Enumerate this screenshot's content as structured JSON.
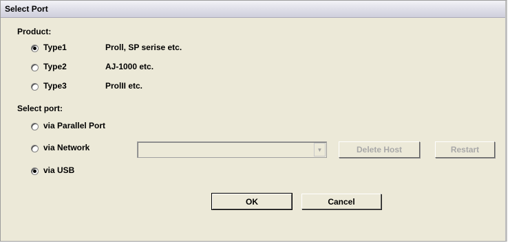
{
  "window": {
    "title": "Select Port"
  },
  "product": {
    "label": "Product:",
    "options": [
      {
        "label": "Type1",
        "desc": "Proll, SP serise etc.",
        "checked": true
      },
      {
        "label": "Type2",
        "desc": "AJ-1000 etc.",
        "checked": false
      },
      {
        "label": "Type3",
        "desc": "ProlII etc.",
        "checked": false
      }
    ]
  },
  "port": {
    "label": "Select port:",
    "options": [
      {
        "label": "via Parallel Port",
        "checked": false
      },
      {
        "label": "via Network",
        "checked": false
      },
      {
        "label": "via USB",
        "checked": true
      }
    ],
    "network_host_value": "",
    "delete_host_label": "Delete Host",
    "restart_label": "Restart"
  },
  "buttons": {
    "ok_label": "OK",
    "cancel_label": "Cancel"
  }
}
